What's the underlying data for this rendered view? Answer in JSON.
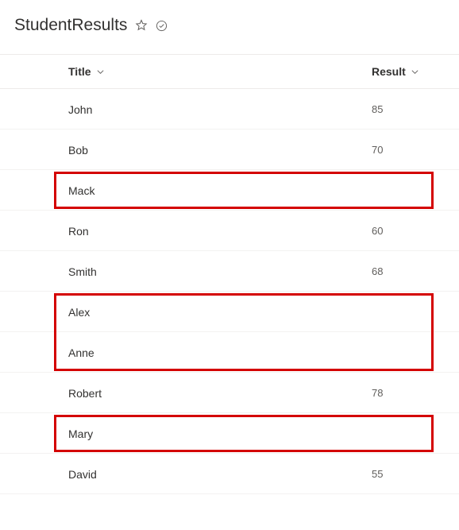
{
  "header": {
    "title": "StudentResults"
  },
  "table": {
    "columns": {
      "title": "Title",
      "result": "Result"
    },
    "rows": [
      {
        "title": "John",
        "result": "85"
      },
      {
        "title": "Bob",
        "result": "70"
      },
      {
        "title": "Mack",
        "result": ""
      },
      {
        "title": "Ron",
        "result": "60"
      },
      {
        "title": "Smith",
        "result": "68"
      },
      {
        "title": "Alex",
        "result": ""
      },
      {
        "title": "Anne",
        "result": ""
      },
      {
        "title": "Robert",
        "result": "78"
      },
      {
        "title": "Mary",
        "result": ""
      },
      {
        "title": "David",
        "result": "55"
      }
    ]
  },
  "annotations": {
    "highlight_color": "#d40000",
    "highlighted_row_groups": [
      {
        "start_index": 2,
        "end_index": 2
      },
      {
        "start_index": 5,
        "end_index": 6
      },
      {
        "start_index": 8,
        "end_index": 8
      }
    ]
  }
}
